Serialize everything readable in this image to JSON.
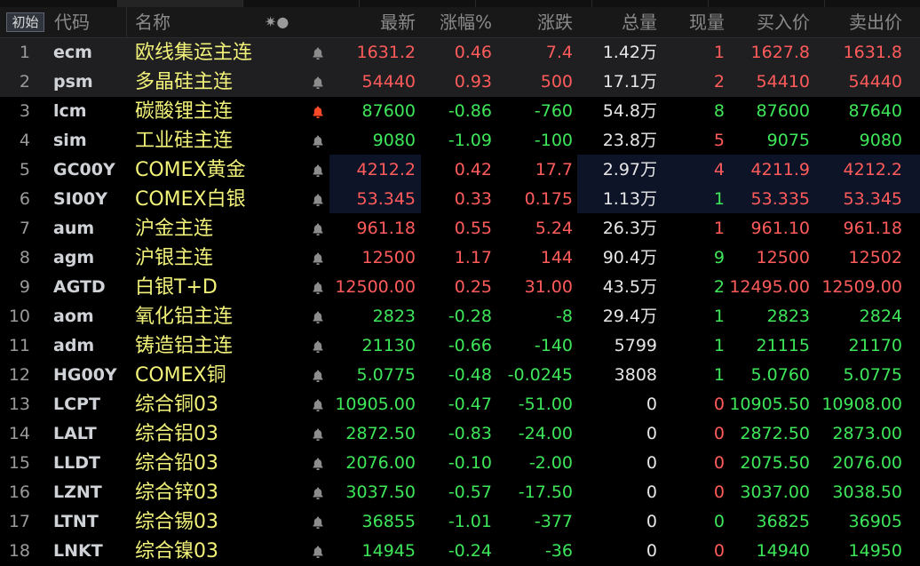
{
  "toolbar": {
    "init_label": "初始"
  },
  "columns": {
    "code": "代码",
    "name": "名称",
    "sort_marker": "✷●",
    "price": "最新",
    "pct": "涨幅%",
    "chg": "涨跌",
    "vol": "总量",
    "cur": "现量",
    "bid": "买入价",
    "ask": "卖出价"
  },
  "colors": {
    "up": "#ff5b5b",
    "down": "#3ee65a",
    "name": "#f2f27a",
    "alert_active": "#ff4a2a"
  },
  "rows": [
    {
      "idx": "1",
      "code": "ecm",
      "name": "欧线集运主连",
      "price": "1631.2",
      "pct": "0.46",
      "chg": "7.4",
      "vol": "1.42万",
      "cur": "1",
      "bid": "1627.8",
      "ask": "1631.8",
      "dir": "up",
      "cur_dir": "up",
      "alert": false,
      "selected": true
    },
    {
      "idx": "2",
      "code": "psm",
      "name": "多晶硅主连",
      "price": "54440",
      "pct": "0.93",
      "chg": "500",
      "vol": "17.1万",
      "cur": "2",
      "bid": "54410",
      "ask": "54440",
      "dir": "up",
      "cur_dir": "up",
      "alert": false,
      "selected": true
    },
    {
      "idx": "3",
      "code": "lcm",
      "name": "碳酸锂主连",
      "price": "87600",
      "pct": "-0.86",
      "chg": "-760",
      "vol": "54.8万",
      "cur": "8",
      "bid": "87600",
      "ask": "87640",
      "dir": "down",
      "cur_dir": "down",
      "alert": true,
      "selected": false
    },
    {
      "idx": "4",
      "code": "sim",
      "name": "工业硅主连",
      "price": "9080",
      "pct": "-1.09",
      "chg": "-100",
      "vol": "23.8万",
      "cur": "5",
      "bid": "9075",
      "ask": "9080",
      "dir": "down",
      "cur_dir": "up",
      "alert": false,
      "selected": false
    },
    {
      "idx": "5",
      "code": "GC00Y",
      "name": "COMEX黄金",
      "price": "4212.2",
      "pct": "0.42",
      "chg": "17.7",
      "vol": "2.97万",
      "cur": "4",
      "bid": "4211.9",
      "ask": "4212.2",
      "dir": "up",
      "cur_dir": "up",
      "alert": false,
      "selected": false
    },
    {
      "idx": "6",
      "code": "SI00Y",
      "name": "COMEX白银",
      "price": "53.345",
      "pct": "0.33",
      "chg": "0.175",
      "vol": "1.13万",
      "cur": "1",
      "bid": "53.335",
      "ask": "53.345",
      "dir": "up",
      "cur_dir": "down",
      "alert": false,
      "selected": false
    },
    {
      "idx": "7",
      "code": "aum",
      "name": "沪金主连",
      "price": "961.18",
      "pct": "0.55",
      "chg": "5.24",
      "vol": "26.3万",
      "cur": "1",
      "bid": "961.10",
      "ask": "961.18",
      "dir": "up",
      "cur_dir": "up",
      "alert": false,
      "selected": false
    },
    {
      "idx": "8",
      "code": "agm",
      "name": "沪银主连",
      "price": "12500",
      "pct": "1.17",
      "chg": "144",
      "vol": "90.4万",
      "cur": "9",
      "bid": "12500",
      "ask": "12502",
      "dir": "up",
      "cur_dir": "down",
      "alert": false,
      "selected": false
    },
    {
      "idx": "9",
      "code": "AGTD",
      "name": "白银T+D",
      "price": "12500.00",
      "pct": "0.25",
      "chg": "31.00",
      "vol": "43.5万",
      "cur": "2",
      "bid": "12495.00",
      "ask": "12509.00",
      "dir": "up",
      "cur_dir": "down",
      "alert": false,
      "selected": false
    },
    {
      "idx": "10",
      "code": "aom",
      "name": "氧化铝主连",
      "price": "2823",
      "pct": "-0.28",
      "chg": "-8",
      "vol": "29.4万",
      "cur": "1",
      "bid": "2823",
      "ask": "2824",
      "dir": "down",
      "cur_dir": "down",
      "alert": false,
      "selected": false
    },
    {
      "idx": "11",
      "code": "adm",
      "name": "铸造铝主连",
      "price": "21130",
      "pct": "-0.66",
      "chg": "-140",
      "vol": "5799",
      "cur": "1",
      "bid": "21115",
      "ask": "21170",
      "dir": "down",
      "cur_dir": "down",
      "alert": false,
      "selected": false
    },
    {
      "idx": "12",
      "code": "HG00Y",
      "name": "COMEX铜",
      "price": "5.0775",
      "pct": "-0.48",
      "chg": "-0.0245",
      "vol": "3808",
      "cur": "1",
      "bid": "5.0760",
      "ask": "5.0775",
      "dir": "down",
      "cur_dir": "down",
      "alert": false,
      "selected": false
    },
    {
      "idx": "13",
      "code": "LCPT",
      "name": "综合铜03",
      "price": "10905.00",
      "pct": "-0.47",
      "chg": "-51.00",
      "vol": "0",
      "cur": "0",
      "bid": "10905.50",
      "ask": "10908.00",
      "dir": "down",
      "cur_dir": "up",
      "alert": false,
      "selected": false
    },
    {
      "idx": "14",
      "code": "LALT",
      "name": "综合铝03",
      "price": "2872.50",
      "pct": "-0.83",
      "chg": "-24.00",
      "vol": "0",
      "cur": "0",
      "bid": "2872.50",
      "ask": "2873.00",
      "dir": "down",
      "cur_dir": "up",
      "alert": false,
      "selected": false
    },
    {
      "idx": "15",
      "code": "LLDT",
      "name": "综合铅03",
      "price": "2076.00",
      "pct": "-0.10",
      "chg": "-2.00",
      "vol": "0",
      "cur": "0",
      "bid": "2075.50",
      "ask": "2076.00",
      "dir": "down",
      "cur_dir": "up",
      "alert": false,
      "selected": false
    },
    {
      "idx": "16",
      "code": "LZNT",
      "name": "综合锌03",
      "price": "3037.50",
      "pct": "-0.57",
      "chg": "-17.50",
      "vol": "0",
      "cur": "0",
      "bid": "3037.00",
      "ask": "3038.50",
      "dir": "down",
      "cur_dir": "up",
      "alert": false,
      "selected": false
    },
    {
      "idx": "17",
      "code": "LTNT",
      "name": "综合锡03",
      "price": "36855",
      "pct": "-1.01",
      "chg": "-377",
      "vol": "0",
      "cur": "0",
      "bid": "36825",
      "ask": "36905",
      "dir": "down",
      "cur_dir": "down",
      "alert": false,
      "selected": false
    },
    {
      "idx": "18",
      "code": "LNKT",
      "name": "综合镍03",
      "price": "14945",
      "pct": "-0.24",
      "chg": "-36",
      "vol": "0",
      "cur": "0",
      "bid": "14940",
      "ask": "14950",
      "dir": "down",
      "cur_dir": "up",
      "alert": false,
      "selected": false
    }
  ]
}
